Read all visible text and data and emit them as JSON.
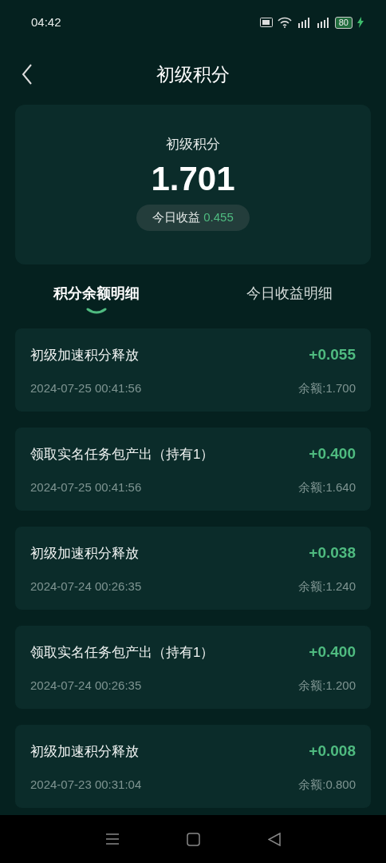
{
  "status_bar": {
    "time": "04:42",
    "battery": "80"
  },
  "header": {
    "title": "初级积分"
  },
  "summary": {
    "label": "初级积分",
    "value": "1.701",
    "today_label": "今日收益",
    "today_value": "0.455"
  },
  "tabs": [
    {
      "label": "积分余额明细",
      "selected": true
    },
    {
      "label": "今日收益明细",
      "selected": false
    }
  ],
  "records": [
    {
      "title": "初级加速积分释放",
      "time": "2024-07-25 00:41:56",
      "amount": "+0.055",
      "balance": "余额:1.700"
    },
    {
      "title": "领取实名任务包产出（持有1）",
      "time": "2024-07-25 00:41:56",
      "amount": "+0.400",
      "balance": "余额:1.640"
    },
    {
      "title": "初级加速积分释放",
      "time": "2024-07-24 00:26:35",
      "amount": "+0.038",
      "balance": "余额:1.240"
    },
    {
      "title": "领取实名任务包产出（持有1）",
      "time": "2024-07-24 00:26:35",
      "amount": "+0.400",
      "balance": "余额:1.200"
    },
    {
      "title": "初级加速积分释放",
      "time": "2024-07-23 00:31:04",
      "amount": "+0.008",
      "balance": "余额:0.800"
    }
  ]
}
